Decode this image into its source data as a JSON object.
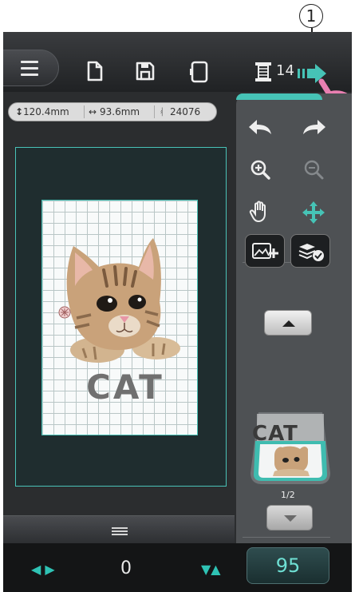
{
  "callout": {
    "number": "1"
  },
  "toolbar": {
    "menu_icon": "hamburger-icon",
    "new_icon": "new-file-icon",
    "save_icon": "save-icon",
    "frame_icon": "frame-icon",
    "spool_icon": "thread-spool-icon",
    "spool_count": "14",
    "send_icon": "send-arrow-icon"
  },
  "info": {
    "height": "120.4mm",
    "width": "93.6mm",
    "stitches": "24076"
  },
  "design": {
    "text": "CAT"
  },
  "panel": {
    "undo_icon": "undo-icon",
    "redo_icon": "redo-icon",
    "zoom_in_icon": "zoom-in-icon",
    "zoom_out_icon": "zoom-out-icon",
    "pan_icon": "hand-icon",
    "move_icon": "move-icon",
    "add_image_icon": "add-image-icon",
    "layers_check_icon": "layers-check-icon",
    "thumb_text": "CAT",
    "pager": "1/2"
  },
  "status": {
    "value_h": "0",
    "value_button": "95"
  },
  "colors": {
    "accent": "#46c3b6",
    "panel": "#4e5154",
    "pointer_hand": "#e97fb1"
  }
}
